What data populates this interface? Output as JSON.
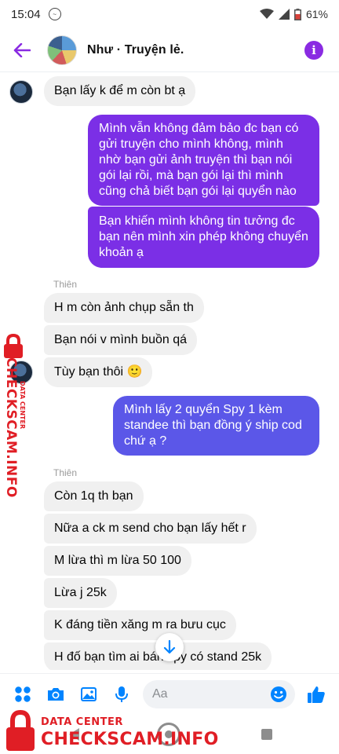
{
  "status_bar": {
    "time": "15:04",
    "battery": "61%"
  },
  "header": {
    "title": "Như · Truyện lẻ."
  },
  "messages": [
    {
      "text": "Bạn lấy k để m còn bt ạ"
    },
    {
      "text": "Mình vẫn không đảm bảo đc bạn có gửi truyện cho mình không, mình nhờ bạn gửi ảnh truyện thì bạn nói gói lại rồi, mà bạn gói lại thì mình cũng chả biết bạn gói lại quyển nào"
    },
    {
      "text": "Bạn khiến mình không tin tưởng đc bạn nên mình xin phép không chuyển khoản ạ"
    },
    {
      "sender": "Thiên"
    },
    {
      "text": "H m còn ảnh chụp sẵn th"
    },
    {
      "text": "Bạn nói v mình buồn qá"
    },
    {
      "text": "Tùy bạn thôi 🙂"
    },
    {
      "text": "Mình lấy 2 quyển Spy 1 kèm standee thì bạn đồng ý ship cod chứ ạ ?"
    },
    {
      "sender": "Thiên"
    },
    {
      "text": "Còn 1q th bạn"
    },
    {
      "text": "Nữa a ck m send cho bạn lấy hết r"
    },
    {
      "text": "M lừa thì m lừa 50 100"
    },
    {
      "text": "Lừa j 25k"
    },
    {
      "text": "K đáng tiền xăng m ra bưu cục"
    },
    {
      "text": "H đố bạn tìm ai bán spy có stand 25k"
    }
  ],
  "composer": {
    "placeholder": "Aa"
  },
  "watermark": {
    "line1": "DATA CENTER",
    "line2": "CHECKSCAM.INFO"
  },
  "colors": {
    "accent": "#8a2be2",
    "bubble_out": "#7b2fe6",
    "bubble_in": "#f0f0f0",
    "composer_icons": "#0084ff",
    "watermark": "#e01e25"
  }
}
